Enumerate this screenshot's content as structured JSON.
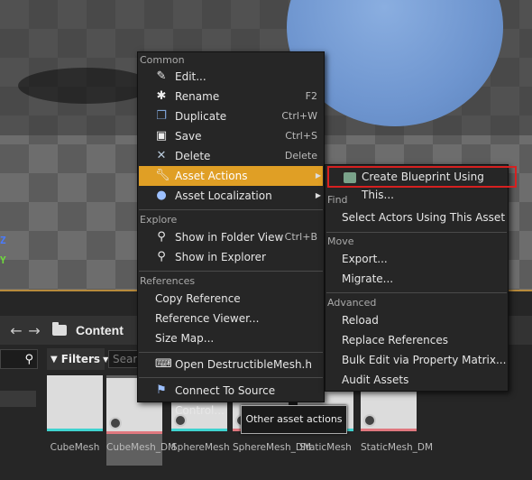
{
  "viewport": {
    "axes": [
      "Z",
      "Y"
    ]
  },
  "content_browser": {
    "crumb": "Content",
    "filters_label": "Filters",
    "search_placeholder": "Search",
    "assets": [
      {
        "name": "CubeMesh"
      },
      {
        "name": "CubeMesh_DM"
      },
      {
        "name": "SphereMesh"
      },
      {
        "name": "SphereMesh_DM"
      },
      {
        "name": "StaticMesh"
      },
      {
        "name": "StaticMesh_DM"
      }
    ]
  },
  "tooltip": "Other asset actions",
  "context_menu": {
    "sections": {
      "common": "Common",
      "explore": "Explore",
      "references": "References"
    },
    "items": {
      "edit": "Edit...",
      "rename": "Rename",
      "rename_sc": "F2",
      "duplicate": "Duplicate",
      "duplicate_sc": "Ctrl+W",
      "save": "Save",
      "save_sc": "Ctrl+S",
      "delete": "Delete",
      "delete_sc": "Delete",
      "asset_actions": "Asset Actions",
      "asset_localization": "Asset Localization",
      "show_folder": "Show in Folder View",
      "show_folder_sc": "Ctrl+B",
      "show_explorer": "Show in Explorer",
      "copy_ref": "Copy Reference",
      "ref_viewer": "Reference Viewer...",
      "size_map": "Size Map...",
      "open_header": "Open DestructibleMesh.h",
      "connect_sc": "Connect To Source Control..."
    }
  },
  "submenu": {
    "sections": {
      "find": "Find",
      "move": "Move",
      "advanced": "Advanced"
    },
    "items": {
      "create_bp": "Create Blueprint Using This...",
      "select_actors": "Select Actors Using This Asset",
      "export": "Export...",
      "migrate": "Migrate...",
      "reload": "Reload",
      "replace_refs": "Replace References",
      "bulk_edit": "Bulk Edit via Property Matrix...",
      "audit": "Audit Assets"
    }
  },
  "colors": {
    "highlight": "#e09f25",
    "callout": "#d62020"
  }
}
